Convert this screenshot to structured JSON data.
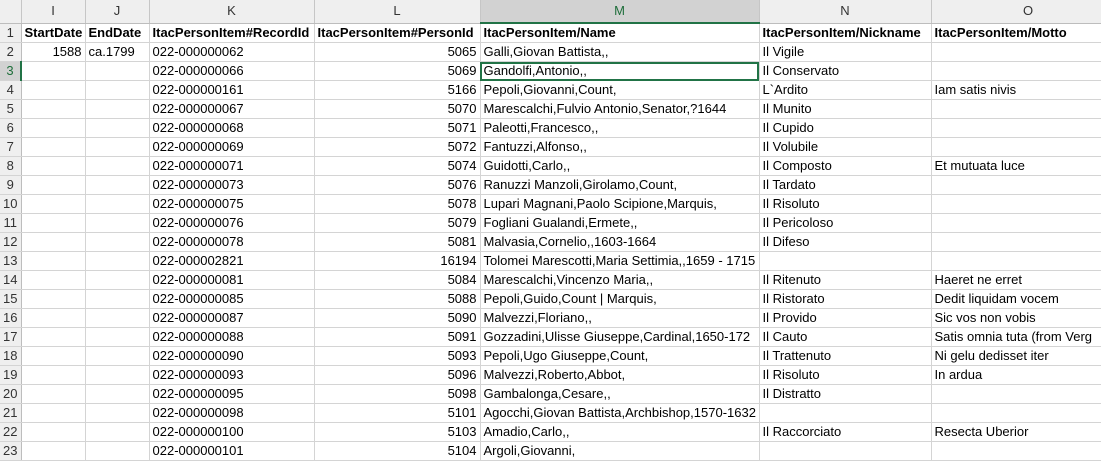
{
  "columns": [
    "I",
    "J",
    "K",
    "L",
    "M",
    "N",
    "O"
  ],
  "selected_column": "M",
  "selected_row": 3,
  "rows": [
    {
      "n": 1,
      "cells": [
        "StartDate",
        "EndDate",
        "ItacPersonItem#RecordId",
        "ItacPersonItem#PersonId",
        "ItacPersonItem/Name",
        "ItacPersonItem/Nickname",
        "ItacPersonItem/Motto"
      ]
    },
    {
      "n": 2,
      "cells": [
        "1588",
        "ca.1799",
        "022-000000062",
        "5065",
        "Galli,Giovan Battista,,",
        "Il Vigile",
        ""
      ]
    },
    {
      "n": 3,
      "cells": [
        "",
        "",
        "022-000000066",
        "5069",
        "Gandolfi,Antonio,,",
        "Il Conservato",
        ""
      ]
    },
    {
      "n": 4,
      "cells": [
        "",
        "",
        "022-000000161",
        "5166",
        "Pepoli,Giovanni,Count,",
        "L`Ardito",
        "Iam satis nivis"
      ]
    },
    {
      "n": 5,
      "cells": [
        "",
        "",
        "022-000000067",
        "5070",
        "Marescalchi,Fulvio Antonio,Senator,?1644",
        "Il Munito",
        ""
      ]
    },
    {
      "n": 6,
      "cells": [
        "",
        "",
        "022-000000068",
        "5071",
        "Paleotti,Francesco,,",
        "Il Cupido",
        ""
      ]
    },
    {
      "n": 7,
      "cells": [
        "",
        "",
        "022-000000069",
        "5072",
        "Fantuzzi,Alfonso,,",
        "Il Volubile",
        ""
      ]
    },
    {
      "n": 8,
      "cells": [
        "",
        "",
        "022-000000071",
        "5074",
        "Guidotti,Carlo,,",
        "Il Composto",
        "Et mutuata luce"
      ]
    },
    {
      "n": 9,
      "cells": [
        "",
        "",
        "022-000000073",
        "5076",
        "Ranuzzi Manzoli,Girolamo,Count,",
        "Il Tardato",
        ""
      ]
    },
    {
      "n": 10,
      "cells": [
        "",
        "",
        "022-000000075",
        "5078",
        "Lupari Magnani,Paolo Scipione,Marquis,",
        "Il Risoluto",
        ""
      ]
    },
    {
      "n": 11,
      "cells": [
        "",
        "",
        "022-000000076",
        "5079",
        "Fogliani Gualandi,Ermete,,",
        "Il Pericoloso",
        ""
      ]
    },
    {
      "n": 12,
      "cells": [
        "",
        "",
        "022-000000078",
        "5081",
        "Malvasia,Cornelio,,1603-1664",
        "Il Difeso",
        ""
      ]
    },
    {
      "n": 13,
      "cells": [
        "",
        "",
        "022-000002821",
        "16194",
        "Tolomei Marescotti,Maria Settimia,,1659 - 1715",
        "",
        ""
      ]
    },
    {
      "n": 14,
      "cells": [
        "",
        "",
        "022-000000081",
        "5084",
        "Marescalchi,Vincenzo Maria,,",
        "Il Ritenuto",
        "Haeret ne erret"
      ]
    },
    {
      "n": 15,
      "cells": [
        "",
        "",
        "022-000000085",
        "5088",
        "Pepoli,Guido,Count  |  Marquis,",
        "Il Ristorato",
        "Dedit liquidam vocem"
      ]
    },
    {
      "n": 16,
      "cells": [
        "",
        "",
        "022-000000087",
        "5090",
        "Malvezzi,Floriano,,",
        "Il Provido",
        "Sic vos non vobis"
      ]
    },
    {
      "n": 17,
      "cells": [
        "",
        "",
        "022-000000088",
        "5091",
        "Gozzadini,Ulisse Giuseppe,Cardinal,1650-172",
        "Il Cauto",
        "Satis omnia tuta (from Verg"
      ]
    },
    {
      "n": 18,
      "cells": [
        "",
        "",
        "022-000000090",
        "5093",
        "Pepoli,Ugo Giuseppe,Count,",
        "Il Trattenuto",
        "Ni gelu dedisset iter"
      ]
    },
    {
      "n": 19,
      "cells": [
        "",
        "",
        "022-000000093",
        "5096",
        "Malvezzi,Roberto,Abbot,",
        "Il Risoluto",
        "In ardua"
      ]
    },
    {
      "n": 20,
      "cells": [
        "",
        "",
        "022-000000095",
        "5098",
        "Gambalonga,Cesare,,",
        "Il Distratto",
        ""
      ]
    },
    {
      "n": 21,
      "cells": [
        "",
        "",
        "022-000000098",
        "5101",
        "Agocchi,Giovan Battista,Archbishop,1570-1632",
        "",
        ""
      ]
    },
    {
      "n": 22,
      "cells": [
        "",
        "",
        "022-000000100",
        "5103",
        "Amadio,Carlo,,",
        "Il Raccorciato",
        "Resecta Uberior"
      ]
    },
    {
      "n": 23,
      "cells": [
        "",
        "",
        "022-000000101",
        "5104",
        "Argoli,Giovanni,",
        "",
        ""
      ]
    }
  ]
}
